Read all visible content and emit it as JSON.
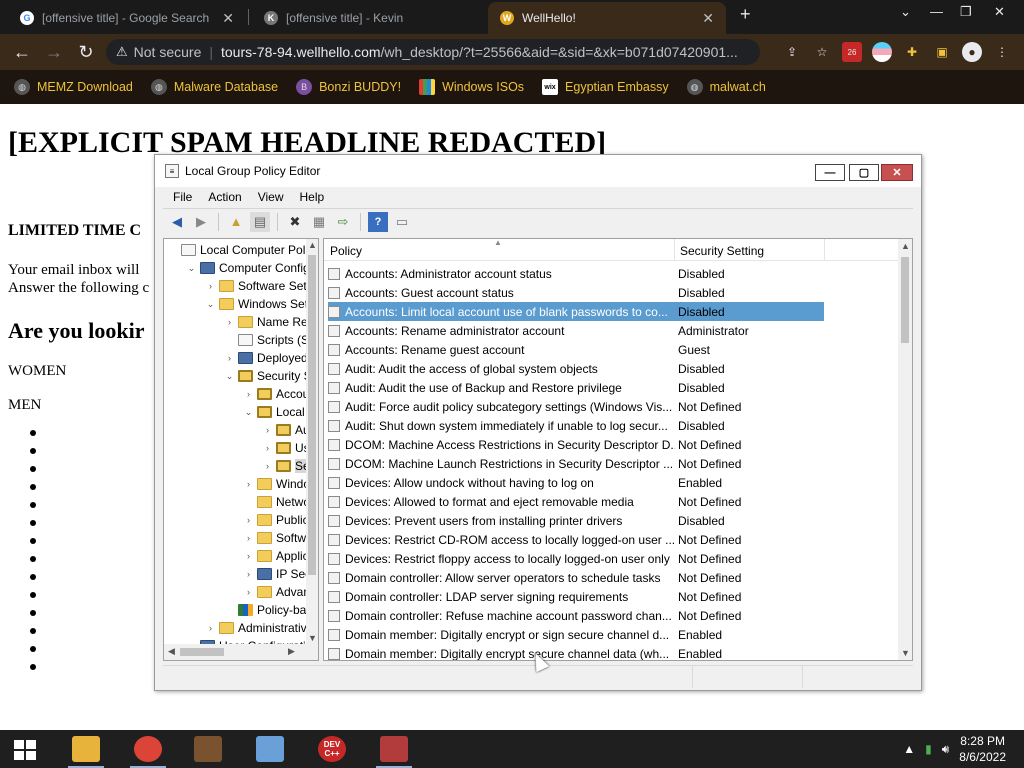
{
  "browser": {
    "tabs": [
      {
        "title": "[offensive title] - Google Search",
        "active": false
      },
      {
        "title": "[offensive title] - Kevin",
        "active": false
      },
      {
        "title": "WellHello!",
        "active": true
      }
    ],
    "new_tab_glyph": "+",
    "window_controls": {
      "minimize": "—",
      "maximize": "❐",
      "close": "✕"
    },
    "address": {
      "security_label": "Not secure",
      "host": "tours-78-94.wellhello.com",
      "path": "/wh_desktop/?t=25566&aid=&sid=&xk=b071d07420901..."
    },
    "extension_badge": "26",
    "bookmarks": [
      {
        "label": "MEMZ Download",
        "icon": "globe-icon"
      },
      {
        "label": "Malware Database",
        "icon": "globe-icon"
      },
      {
        "label": "Bonzi BUDDY!",
        "icon": "bonzi-icon"
      },
      {
        "label": "Windows ISOs",
        "icon": "windows-icon"
      },
      {
        "label": "Egyptian Embassy",
        "icon": "wix-icon"
      },
      {
        "label": "malwat.ch",
        "icon": "globe-icon"
      }
    ]
  },
  "page": {
    "headline": "[EXPLICIT SPAM HEADLINE REDACTED]",
    "offer": "LIMITED TIME C",
    "inbox_line1": "Your email inbox will",
    "inbox_line2": "Answer the following c",
    "question": "Are you lookir",
    "option_women": "WOMEN",
    "option_men": "MEN",
    "bullet_count": 14
  },
  "gpe": {
    "title": "Local Group Policy Editor",
    "menu": [
      "File",
      "Action",
      "View",
      "Help"
    ],
    "tree": [
      {
        "label": "Local Computer Polic",
        "level": 0,
        "icon": "doc",
        "exp": ""
      },
      {
        "label": "Computer Config",
        "level": 1,
        "icon": "computer",
        "exp": "⌄"
      },
      {
        "label": "Software Setti",
        "level": 2,
        "icon": "folder",
        "exp": "›"
      },
      {
        "label": "Windows Sett",
        "level": 2,
        "icon": "folder",
        "exp": "⌄"
      },
      {
        "label": "Name Res",
        "level": 3,
        "icon": "folder",
        "exp": "›"
      },
      {
        "label": "Scripts (Sta",
        "level": 3,
        "icon": "doc",
        "exp": ""
      },
      {
        "label": "Deployed",
        "level": 3,
        "icon": "computer",
        "exp": "›"
      },
      {
        "label": "Security Se",
        "level": 3,
        "icon": "lock",
        "exp": "⌄"
      },
      {
        "label": "Accou",
        "level": 4,
        "icon": "lock",
        "exp": "›"
      },
      {
        "label": "Local F",
        "level": 4,
        "icon": "lock",
        "exp": "⌄"
      },
      {
        "label": "Au",
        "level": 5,
        "icon": "lock",
        "exp": "›"
      },
      {
        "label": "Use",
        "level": 5,
        "icon": "lock",
        "exp": "›"
      },
      {
        "label": "Sec",
        "level": 5,
        "icon": "lock",
        "exp": "›",
        "selected": true
      },
      {
        "label": "Windo",
        "level": 4,
        "icon": "folder",
        "exp": "›"
      },
      {
        "label": "Netwo",
        "level": 4,
        "icon": "folder",
        "exp": ""
      },
      {
        "label": "Public",
        "level": 4,
        "icon": "folder",
        "exp": "›"
      },
      {
        "label": "Softwa",
        "level": 4,
        "icon": "folder",
        "exp": "›"
      },
      {
        "label": "Applic",
        "level": 4,
        "icon": "folder",
        "exp": "›"
      },
      {
        "label": "IP Secu",
        "level": 4,
        "icon": "computer",
        "exp": "›"
      },
      {
        "label": "Advan",
        "level": 4,
        "icon": "folder",
        "exp": "›"
      },
      {
        "label": "Policy-bas",
        "level": 3,
        "icon": "chart",
        "exp": ""
      },
      {
        "label": "Administrative",
        "level": 2,
        "icon": "folder",
        "exp": "›"
      },
      {
        "label": "User Configuration",
        "level": 1,
        "icon": "computer",
        "exp": "⌄"
      }
    ],
    "columns": {
      "policy": "Policy",
      "setting": "Security Setting"
    },
    "rows": [
      {
        "policy": "Accounts: Administrator account status",
        "setting": "Disabled"
      },
      {
        "policy": "Accounts: Guest account status",
        "setting": "Disabled"
      },
      {
        "policy": "Accounts: Limit local account use of blank passwords to co...",
        "setting": "Disabled",
        "selected": true
      },
      {
        "policy": "Accounts: Rename administrator account",
        "setting": "Administrator"
      },
      {
        "policy": "Accounts: Rename guest account",
        "setting": "Guest"
      },
      {
        "policy": "Audit: Audit the access of global system objects",
        "setting": "Disabled"
      },
      {
        "policy": "Audit: Audit the use of Backup and Restore privilege",
        "setting": "Disabled"
      },
      {
        "policy": "Audit: Force audit policy subcategory settings (Windows Vis...",
        "setting": "Not Defined"
      },
      {
        "policy": "Audit: Shut down system immediately if unable to log secur...",
        "setting": "Disabled"
      },
      {
        "policy": "DCOM: Machine Access Restrictions in Security Descriptor D...",
        "setting": "Not Defined"
      },
      {
        "policy": "DCOM: Machine Launch Restrictions in Security Descriptor ...",
        "setting": "Not Defined"
      },
      {
        "policy": "Devices: Allow undock without having to log on",
        "setting": "Enabled"
      },
      {
        "policy": "Devices: Allowed to format and eject removable media",
        "setting": "Not Defined"
      },
      {
        "policy": "Devices: Prevent users from installing printer drivers",
        "setting": "Disabled"
      },
      {
        "policy": "Devices: Restrict CD-ROM access to locally logged-on user ...",
        "setting": "Not Defined"
      },
      {
        "policy": "Devices: Restrict floppy access to locally logged-on user only",
        "setting": "Not Defined"
      },
      {
        "policy": "Domain controller: Allow server operators to schedule tasks",
        "setting": "Not Defined"
      },
      {
        "policy": "Domain controller: LDAP server signing requirements",
        "setting": "Not Defined"
      },
      {
        "policy": "Domain controller: Refuse machine account password chan...",
        "setting": "Not Defined"
      },
      {
        "policy": "Domain member: Digitally encrypt or sign secure channel d...",
        "setting": "Enabled"
      },
      {
        "policy": "Domain member: Digitally encrypt secure channel data (wh...",
        "setting": "Enabled"
      }
    ]
  },
  "taskbar": {
    "apps": [
      {
        "name": "file-explorer",
        "color": "#e8b33a",
        "label": ""
      },
      {
        "name": "chrome",
        "color": "#db4437",
        "label": ""
      },
      {
        "name": "winrar",
        "color": "#7a5230",
        "label": ""
      },
      {
        "name": "paint",
        "color": "#6aa0d8",
        "label": ""
      },
      {
        "name": "devcpp",
        "color": "#c62828",
        "label": "DEV C++"
      },
      {
        "name": "toolbox",
        "color": "#b23b3b",
        "label": ""
      }
    ],
    "time": "8:28 PM",
    "date": "8/6/2022"
  },
  "colors": {
    "selection": "#5a9bd0",
    "bookmark_text": "#f0c23a",
    "chrome_bg": "#3a2a1a"
  }
}
